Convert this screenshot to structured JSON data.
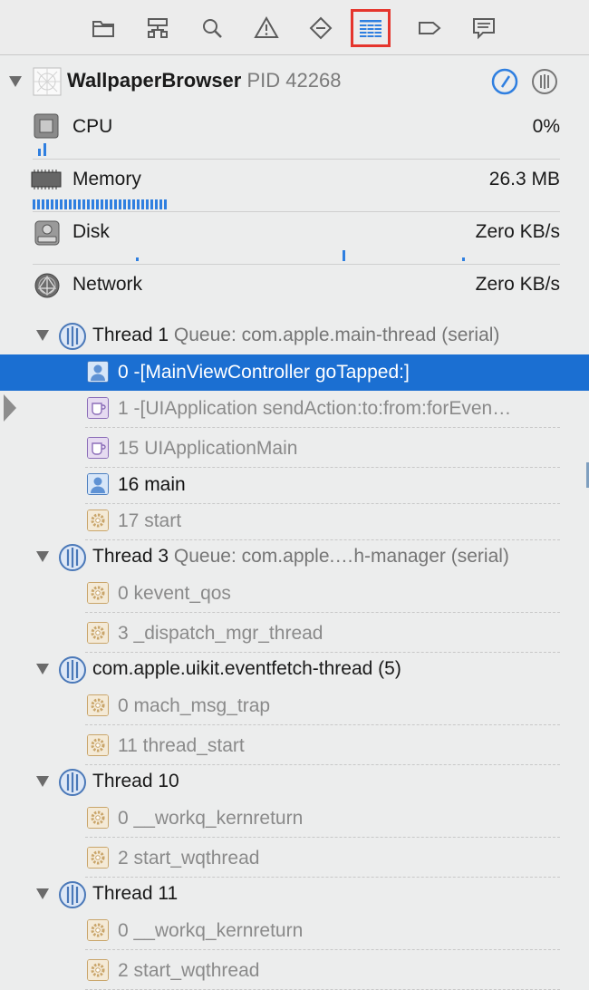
{
  "toolbar": {
    "icons": [
      "folder-icon",
      "hierarchy-icon",
      "search-icon",
      "warning-icon",
      "breakpoint-icon",
      "debug-navigator-icon",
      "tag-icon",
      "report-icon"
    ],
    "active_index": 5,
    "active_outline_color": "#e5352d"
  },
  "process": {
    "name": "WallpaperBrowser",
    "pid": "PID 42268"
  },
  "gauges": [
    {
      "label": "CPU",
      "value": "0%"
    },
    {
      "label": "Memory",
      "value": "26.3 MB"
    },
    {
      "label": "Disk",
      "value": "Zero KB/s"
    },
    {
      "label": "Network",
      "value": "Zero KB/s"
    }
  ],
  "threads": [
    {
      "title": "Thread 1",
      "queue": "Queue: com.apple.main-thread (serial)",
      "frames": [
        {
          "text": "0 -[MainViewController goTapped:]",
          "kind": "user",
          "selected": true
        },
        {
          "text": "1 -[UIApplication sendAction:to:from:forEven…",
          "kind": "framework"
        },
        {
          "text": "15 UIApplicationMain",
          "kind": "framework"
        },
        {
          "text": "16 main",
          "kind": "user"
        },
        {
          "text": "17 start",
          "kind": "system"
        }
      ]
    },
    {
      "title": "Thread 3",
      "queue": "Queue: com.apple.…h-manager (serial)",
      "frames": [
        {
          "text": "0 kevent_qos",
          "kind": "system"
        },
        {
          "text": "3 _dispatch_mgr_thread",
          "kind": "system"
        }
      ]
    },
    {
      "title": "com.apple.uikit.eventfetch-thread (5)",
      "queue": "",
      "frames": [
        {
          "text": "0 mach_msg_trap",
          "kind": "system"
        },
        {
          "text": "11 thread_start",
          "kind": "system"
        }
      ]
    },
    {
      "title": "Thread 10",
      "queue": "",
      "frames": [
        {
          "text": "0 __workq_kernreturn",
          "kind": "system"
        },
        {
          "text": "2 start_wqthread",
          "kind": "system"
        }
      ]
    },
    {
      "title": "Thread 11",
      "queue": "",
      "frames": [
        {
          "text": "0 __workq_kernreturn",
          "kind": "system"
        },
        {
          "text": "2 start_wqthread",
          "kind": "system"
        }
      ]
    }
  ],
  "colors": {
    "selection": "#1b6fd2",
    "accent": "#2f7fe0"
  }
}
